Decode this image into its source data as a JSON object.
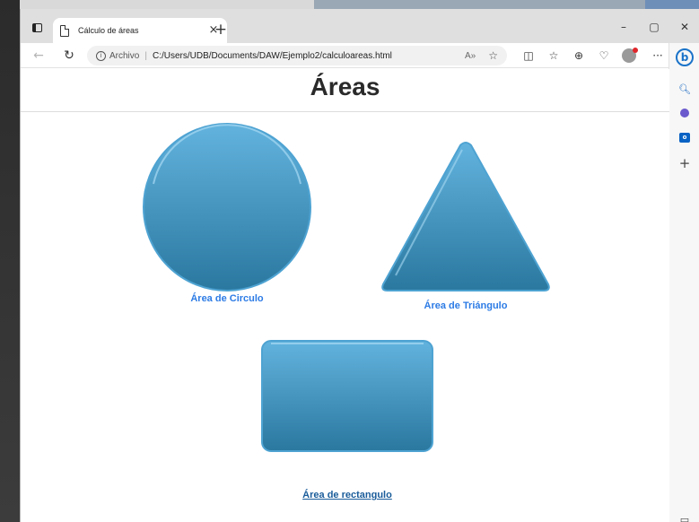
{
  "browser": {
    "tab_title": "Cálculo de áreas",
    "tab_close": "×",
    "new_tab": "+",
    "window_controls": [
      "–",
      "▢",
      "✕"
    ],
    "address": {
      "site_label": "Archivo",
      "separator": "|",
      "url": "C:/Users/UDB/Documents/DAW/Ejemplo2/calculoareas.html"
    },
    "sidebar_icons": [
      "bing-icon",
      "search-icon",
      "shopping-icon",
      "outlook-icon",
      "add-icon"
    ]
  },
  "page": {
    "title": "Áreas",
    "links": {
      "circle": "Área de Circulo",
      "triangle": "Área de Triángulo",
      "rectangle": "Área de rectangulo"
    }
  },
  "colors": {
    "shape_top": "#5fb0dc",
    "shape_bottom": "#2a79a1",
    "link": "#2c7be5",
    "link_visited": "#1a5c9a"
  }
}
